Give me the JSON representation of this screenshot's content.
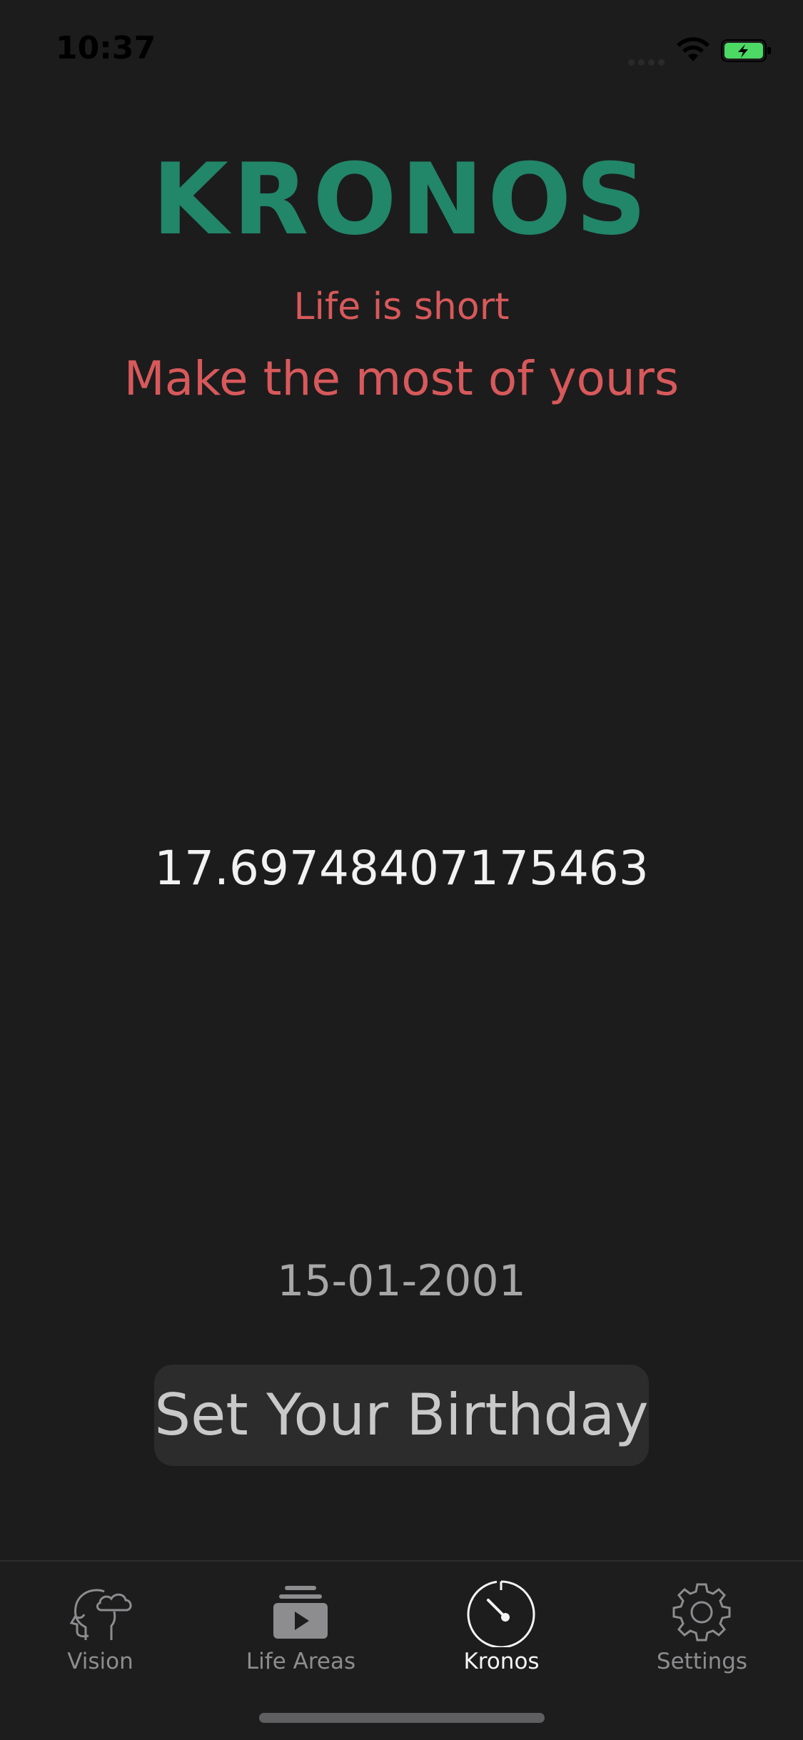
{
  "status_bar": {
    "time": "10:37"
  },
  "header": {
    "title": "KRONOS",
    "tagline_1": "Life is short",
    "tagline_2": "Make the most of yours"
  },
  "main": {
    "age_value": "17.69748407175463",
    "birth_date": "15-01-2001",
    "set_birthday_label": "Set Your Birthday"
  },
  "tab_bar": {
    "active_tab": "Kronos",
    "tabs": [
      {
        "label": "Vision",
        "icon": "head-thought-icon"
      },
      {
        "label": "Life Areas",
        "icon": "play-stack-icon"
      },
      {
        "label": "Kronos",
        "icon": "timer-icon"
      },
      {
        "label": "Settings",
        "icon": "gear-icon"
      }
    ]
  },
  "colors": {
    "background": "#1c1c1d",
    "title": "#228668",
    "tagline": "#d8595b",
    "tab_active": "#f5f5f5",
    "tab_inactive": "#8d8d8f",
    "battery": "#4cd964"
  }
}
